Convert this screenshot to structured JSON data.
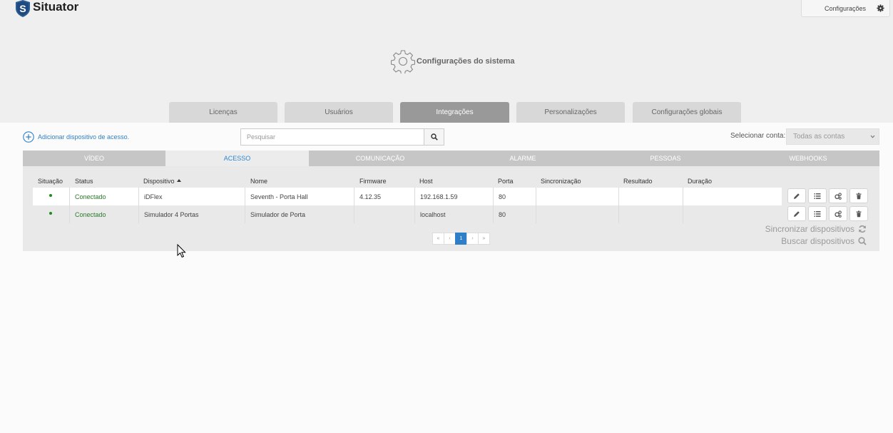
{
  "app": {
    "brand": "Situator",
    "config_button": "Configurações"
  },
  "page": {
    "title": "Configurações do sistema"
  },
  "tabs": [
    {
      "label": "Licenças"
    },
    {
      "label": "Usuários"
    },
    {
      "label": "Integrações",
      "active": true
    },
    {
      "label": "Personalizações"
    },
    {
      "label": "Configurações globais"
    }
  ],
  "toolbar": {
    "add_device": "Adicionar dispositivo de acesso.",
    "search_placeholder": "Pesquisar",
    "account_label": "Selecionar conta:",
    "account_value": "Todas as contas"
  },
  "subtabs": [
    {
      "label": "VÍDEO"
    },
    {
      "label": "ACESSO",
      "active": true
    },
    {
      "label": "COMUNICAÇÃO"
    },
    {
      "label": "ALARME"
    },
    {
      "label": "PESSOAS"
    },
    {
      "label": "WEBHOOKS"
    }
  ],
  "table": {
    "headers": [
      "Situação",
      "Status",
      "Dispositivo",
      "Nome",
      "Firmware",
      "Host",
      "Porta",
      "Sincronização",
      "Resultado",
      "Duração"
    ],
    "rows": [
      {
        "status": "Conectado",
        "device": "iDFlex",
        "name": "Seventh - Porta Hall",
        "firmware": "4.12.35",
        "host": "192.168.1.59",
        "port": "80",
        "sync": "",
        "result": "",
        "duration": ""
      },
      {
        "status": "Conectado",
        "device": "Simulador 4 Portas",
        "name": "Simulador de Porta",
        "firmware": "",
        "host": "localhost",
        "port": "80",
        "sync": "",
        "result": "",
        "duration": ""
      }
    ]
  },
  "pagination": {
    "first": "«",
    "prev": "‹",
    "current": "1",
    "next": "›",
    "last": "»"
  },
  "side_actions": {
    "sync": "Sincronizar dispositivos",
    "search": "Buscar dispositivos"
  },
  "colors": {
    "accent": "#2f7fc8",
    "connected": "#2a7a2a",
    "tab_active": "#999999"
  }
}
